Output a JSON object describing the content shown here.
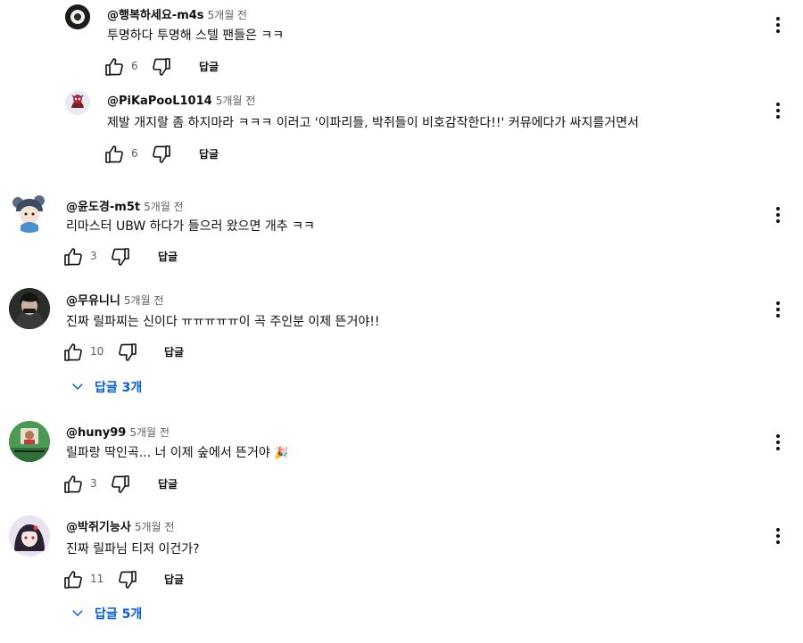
{
  "comments": [
    {
      "author": "@행복하세요-m4s",
      "time": "5개월 전",
      "text": "투명하다 투명해 스텔 팬들은 ㅋㅋ",
      "likes": "6",
      "reply_label": "답글"
    },
    {
      "author": "@PiKaPooL1014",
      "time": "5개월 전",
      "text": "제발 개지랄 좀 하지마라 ㅋㅋㅋ 이러고 '이파리들, 박쥐들이 비호감작한다!!' 커뮤에다가 싸지를거면서",
      "likes": "6",
      "reply_label": "답글"
    },
    {
      "author": "@윤도경-m5t",
      "time": "5개월 전",
      "text": "리마스터 UBW 하다가 들으러 왔으면 개추 ㅋㅋ",
      "likes": "3",
      "reply_label": "답글"
    },
    {
      "author": "@무유니니",
      "time": "5개월 전",
      "text": "진짜 릴파찌는 신이다 ㅠㅠㅠㅠㅠ이 곡  주인분 이제 뜬거야!!",
      "likes": "10",
      "reply_label": "답글",
      "replies_toggle": "답글 3개"
    },
    {
      "author": "@huny99",
      "time": "5개월 전",
      "text": "릴파랑 딱인곡...  너 이제 숲에서 뜬거야",
      "emoji": "🎉",
      "likes": "3",
      "reply_label": "답글"
    },
    {
      "author": "@박쥐기능사",
      "time": "5개월 전",
      "text": "진짜 릴파님 티저 이건가?",
      "likes": "11",
      "reply_label": "답글",
      "replies_toggle": "답글 5개"
    }
  ],
  "icons": {
    "like": "thumb-up-icon",
    "dislike": "thumb-down-icon",
    "menu": "more-vert-icon",
    "expand": "chevron-down-icon"
  },
  "colors": {
    "link": "#065fd4",
    "meta": "#606060",
    "text": "#0f0f0f"
  }
}
